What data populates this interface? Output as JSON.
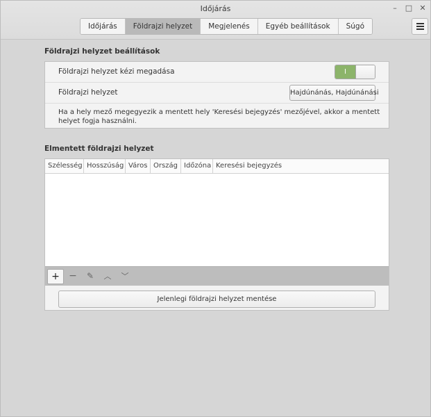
{
  "window": {
    "title": "Időjárás",
    "controls": {
      "minimize": "–",
      "maximize": "□",
      "close": "✕"
    }
  },
  "tabs": [
    {
      "label": "Időjárás",
      "active": false
    },
    {
      "label": "Földrajzi helyzet",
      "active": true
    },
    {
      "label": "Megjelenés",
      "active": false
    },
    {
      "label": "Egyéb beállítások",
      "active": false
    },
    {
      "label": "Súgó",
      "active": false
    }
  ],
  "menu_icon": "hamburger-menu-icon",
  "location_settings": {
    "title": "Földrajzi helyzet beállítások",
    "manual_label": "Földrajzi helyzet kézi megadása",
    "manual_switch_on_text": "I",
    "location_label": "Földrajzi helyzet",
    "location_value": "Hajdúnánás, Hajdúnánási",
    "info": "Ha a hely mező megegyezik a mentett hely 'Keresési bejegyzés' mezőjével, akkor a mentett helyet fogja használni."
  },
  "saved_locations": {
    "title": "Elmentett földrajzi helyzet",
    "columns": [
      "Szélesség",
      "Hosszúság",
      "Város",
      "Ország",
      "Időzóna",
      "Keresési bejegyzés"
    ],
    "rows": [],
    "toolbar": {
      "add": "+",
      "remove": "−",
      "edit": "✎",
      "move_up": "︿",
      "move_down": "﹀"
    },
    "save_button": "Jelenlegi földrajzi helyzet mentése"
  },
  "colors": {
    "switch_on": "#8cb46a",
    "active_tab": "#b9b9b9"
  }
}
